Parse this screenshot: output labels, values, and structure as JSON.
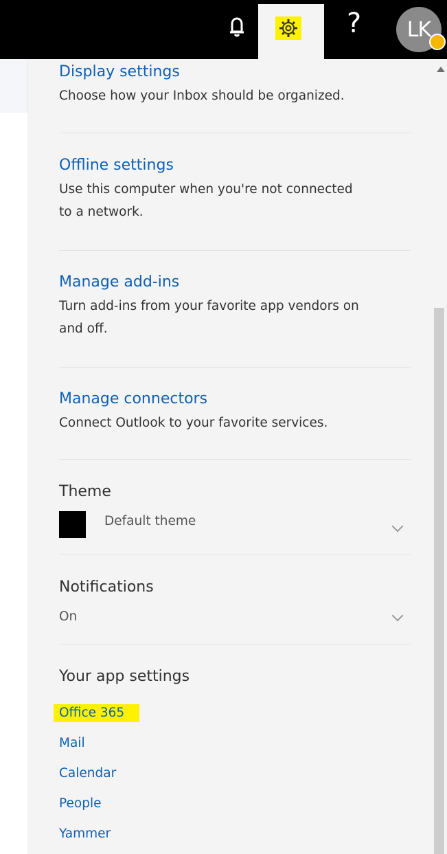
{
  "topbar": {
    "icons": [
      "skype-icon",
      "bell-icon",
      "gear-icon",
      "help-icon"
    ],
    "help_label": "?",
    "avatar_initials": "LK",
    "highlight_color": "#fff200"
  },
  "settings": {
    "display": {
      "title": "Display settings",
      "description": "Choose how your Inbox should be organized."
    },
    "offline": {
      "title": "Offline settings",
      "description_line1": "Use this computer when you're not connected",
      "description_line2": "to a network."
    },
    "addins": {
      "title": "Manage add-ins",
      "description_line1": "Turn add-ins from your favorite app vendors on",
      "description_line2": "and off."
    },
    "connectors": {
      "title": "Manage connectors",
      "description": "Connect Outlook to your favorite services."
    },
    "theme": {
      "heading": "Theme",
      "selected": "Default theme"
    },
    "notifications": {
      "heading": "Notifications",
      "selected": "On"
    },
    "app_settings": {
      "heading": "Your app settings",
      "items": [
        "Office 365",
        "Mail",
        "Calendar",
        "People",
        "Yammer"
      ]
    }
  },
  "colors": {
    "link": "#0f61b4",
    "topbar": "#000000",
    "panel": "#f4f4f4"
  }
}
